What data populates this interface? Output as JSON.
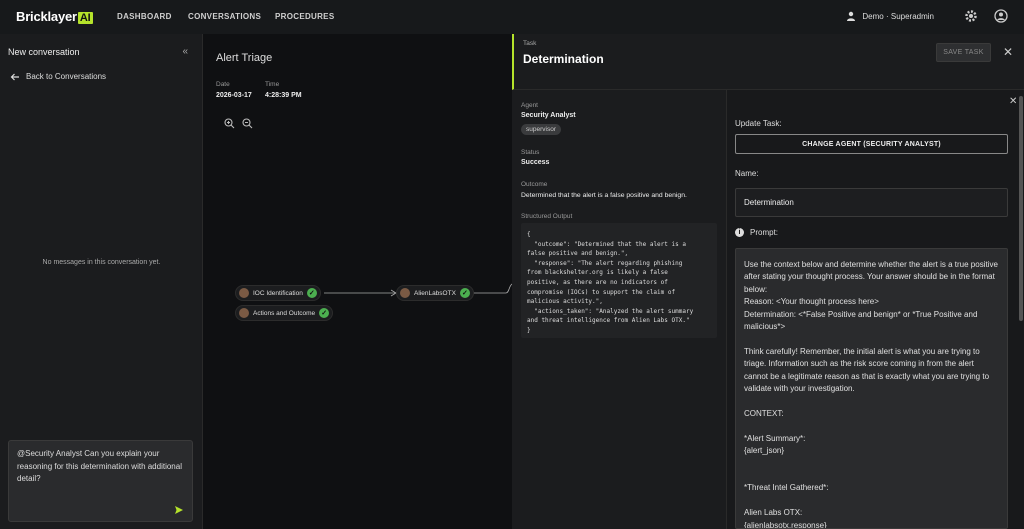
{
  "nav": {
    "brand": "Bricklayer",
    "brand_badge": "AI",
    "links": [
      "DASHBOARD",
      "CONVERSATIONS",
      "PROCEDURES"
    ],
    "user": "Demo · Superadmin"
  },
  "left": {
    "title": "New conversation",
    "back": "Back to Conversations",
    "empty": "No messages in this conversation yet.",
    "chat_text": "@Security Analyst Can you explain your reasoning for this determination with additional detail?"
  },
  "canvas": {
    "title": "Alert Triage",
    "date_label": "Date",
    "date": "2026-03-17",
    "time_label": "Time",
    "time": "4:28:39 PM",
    "nodes": [
      "IOC Identification",
      "Actions and Outcome",
      "AlienLabsOTX"
    ]
  },
  "task": {
    "label": "Task",
    "name": "Determination",
    "save": "SAVE TASK"
  },
  "details": {
    "agent_label": "Agent",
    "agent": "Security Analyst",
    "agent_badge": "supervisor",
    "status_label": "Status",
    "status": "Success",
    "outcome_label": "Outcome",
    "outcome": "Determined that the alert is a false positive and benign.",
    "structured_label": "Structured Output",
    "structured": "{\n  \"outcome\": \"Determined that the alert is a\nfalse positive and benign.\",\n  \"response\": \"The alert regarding phishing\nfrom blackshelter.org is likely a false\npositive, as there are no indicators of\ncompromise (IOCs) to support the claim of\nmalicious activity.\",\n  \"actions_taken\": \"Analyzed the alert summary\nand threat intelligence from Alien Labs OTX.\"\n}"
  },
  "editor": {
    "update_label": "Update Task:",
    "change_agent": "CHANGE AGENT (SECURITY ANALYST)",
    "name_label": "Name:",
    "name_value": "Determination",
    "prompt_label": "Prompt:",
    "prompt_text": "Use the context below and determine whether the alert is a true positive after stating your thought process. Your answer should be in the format below:\nReason: <Your thought process here>\nDetermination: <*False Positive and benign* or *True Positive and malicious*>\n\nThink carefully! Remember, the initial alert is what you are trying to triage. Information such as the risk score coming in from the alert cannot be a legitimate reason as that is exactly what you are trying to validate with your investigation.\n\nCONTEXT:\n\n*Alert Summary*:\n{alert_json}\n\n\n*Threat Intel Gathered*:\n\nAlien Labs OTX:\n{alienlabsotx.response}"
  },
  "colors": {
    "accent": "#b5e32b",
    "success": "#4caf50"
  }
}
